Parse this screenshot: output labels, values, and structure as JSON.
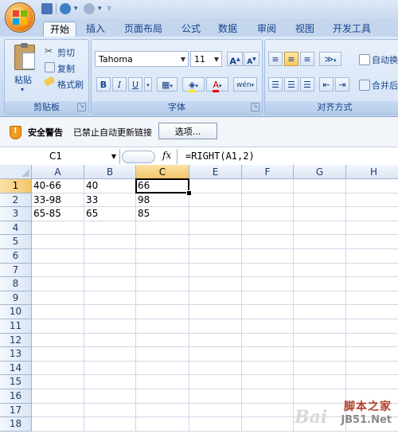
{
  "ribbon": {
    "tabs": [
      {
        "label": "开始",
        "active": true
      },
      {
        "label": "插入"
      },
      {
        "label": "页面布局"
      },
      {
        "label": "公式"
      },
      {
        "label": "数据"
      },
      {
        "label": "审阅"
      },
      {
        "label": "视图"
      },
      {
        "label": "开发工具"
      }
    ],
    "clipboard": {
      "group_label": "剪贴板",
      "paste_label": "粘贴",
      "cut_label": "剪切",
      "copy_label": "复制",
      "format_painter_label": "格式刷"
    },
    "font": {
      "group_label": "字体",
      "font_name": "Tahoma",
      "font_size": "11",
      "grow_label": "A",
      "shrink_label": "A",
      "bold_label": "B",
      "italic_label": "I",
      "underline_label": "U",
      "font_color_label": "A",
      "phonetic_label": "wén"
    },
    "alignment": {
      "group_label": "对齐方式",
      "wrap_label": "自动换",
      "merge_label": "合并后"
    }
  },
  "security_bar": {
    "title": "安全警告",
    "message": "已禁止自动更新链接",
    "options_button": "选项..."
  },
  "formula_bar": {
    "name_box": "C1",
    "fx_label": "fx",
    "formula": "=RIGHT(A1,2)"
  },
  "sheet": {
    "columns": [
      "A",
      "B",
      "C",
      "E",
      "F",
      "G",
      "H"
    ],
    "selected_column": "C",
    "rows": [
      "1",
      "2",
      "3",
      "4",
      "5",
      "6",
      "7",
      "8",
      "9",
      "10",
      "11",
      "12",
      "13",
      "14",
      "15",
      "16",
      "17",
      "18"
    ],
    "selected_row": "1",
    "cells": [
      [
        "40-66",
        "40",
        "66"
      ],
      [
        "33-98",
        "33",
        "98"
      ],
      [
        "65-85",
        "65",
        "85"
      ]
    ]
  },
  "watermark": {
    "line1": "脚本之家",
    "line2": "JB51.Net",
    "baidu": "Bai"
  },
  "colors": {
    "accent": "#15428b",
    "selected_header": "#f3c56a",
    "ribbon_bg": "#cbdcf2"
  }
}
